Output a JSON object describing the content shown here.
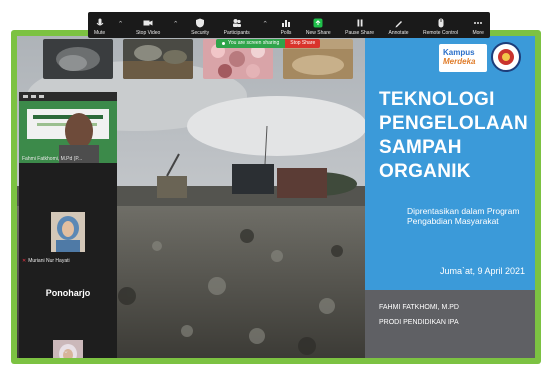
{
  "toolbar": {
    "items": [
      {
        "label": "Mute",
        "icon": "microphone-icon"
      },
      {
        "label": "Stop Video",
        "icon": "video-camera-icon"
      },
      {
        "label": "Security",
        "icon": "shield-icon"
      },
      {
        "label": "Participants",
        "icon": "participants-icon",
        "badge": "17"
      },
      {
        "label": "Polls",
        "icon": "bar-chart-icon"
      },
      {
        "label": "New Share",
        "icon": "share-screen-icon"
      },
      {
        "label": "Pause Share",
        "icon": "pause-icon"
      },
      {
        "label": "Annotate",
        "icon": "pen-icon"
      },
      {
        "label": "Remote Control",
        "icon": "mouse-icon"
      },
      {
        "label": "More",
        "icon": "more-dots-icon"
      }
    ]
  },
  "share_bar": {
    "notice": "You are screen sharing",
    "stop_label": "Stop Share"
  },
  "slide": {
    "logo_line1": "Kampus",
    "logo_line2": "Merdeka",
    "title_lines": [
      "TEKNOLOGI",
      "PENGELOLAAN",
      "SAMPAH",
      "ORGANIK"
    ],
    "description": "Diprentasikan dalam Program Pengabdian Masyarakat",
    "date": "Juma`at, 9 April 2021",
    "presenter_name": "FAHMI FATKHOMI, M.PD",
    "presenter_dept": "PRODI PENDIDIKAN IPA"
  },
  "participants": {
    "tile1_name": "Fahmi Fatkhomi, M.Pd (P...",
    "tile2_name": "Muriani Nur Hayati",
    "tile3_name": "Ponoharjo"
  },
  "colors": {
    "frame_green": "#7cc242",
    "slide_blue": "#3b9ad9",
    "slide_gray": "#5f6064",
    "toolbar_bg": "#1a1a1a",
    "share_green": "#2fa44a",
    "stop_red": "#d9342b"
  }
}
